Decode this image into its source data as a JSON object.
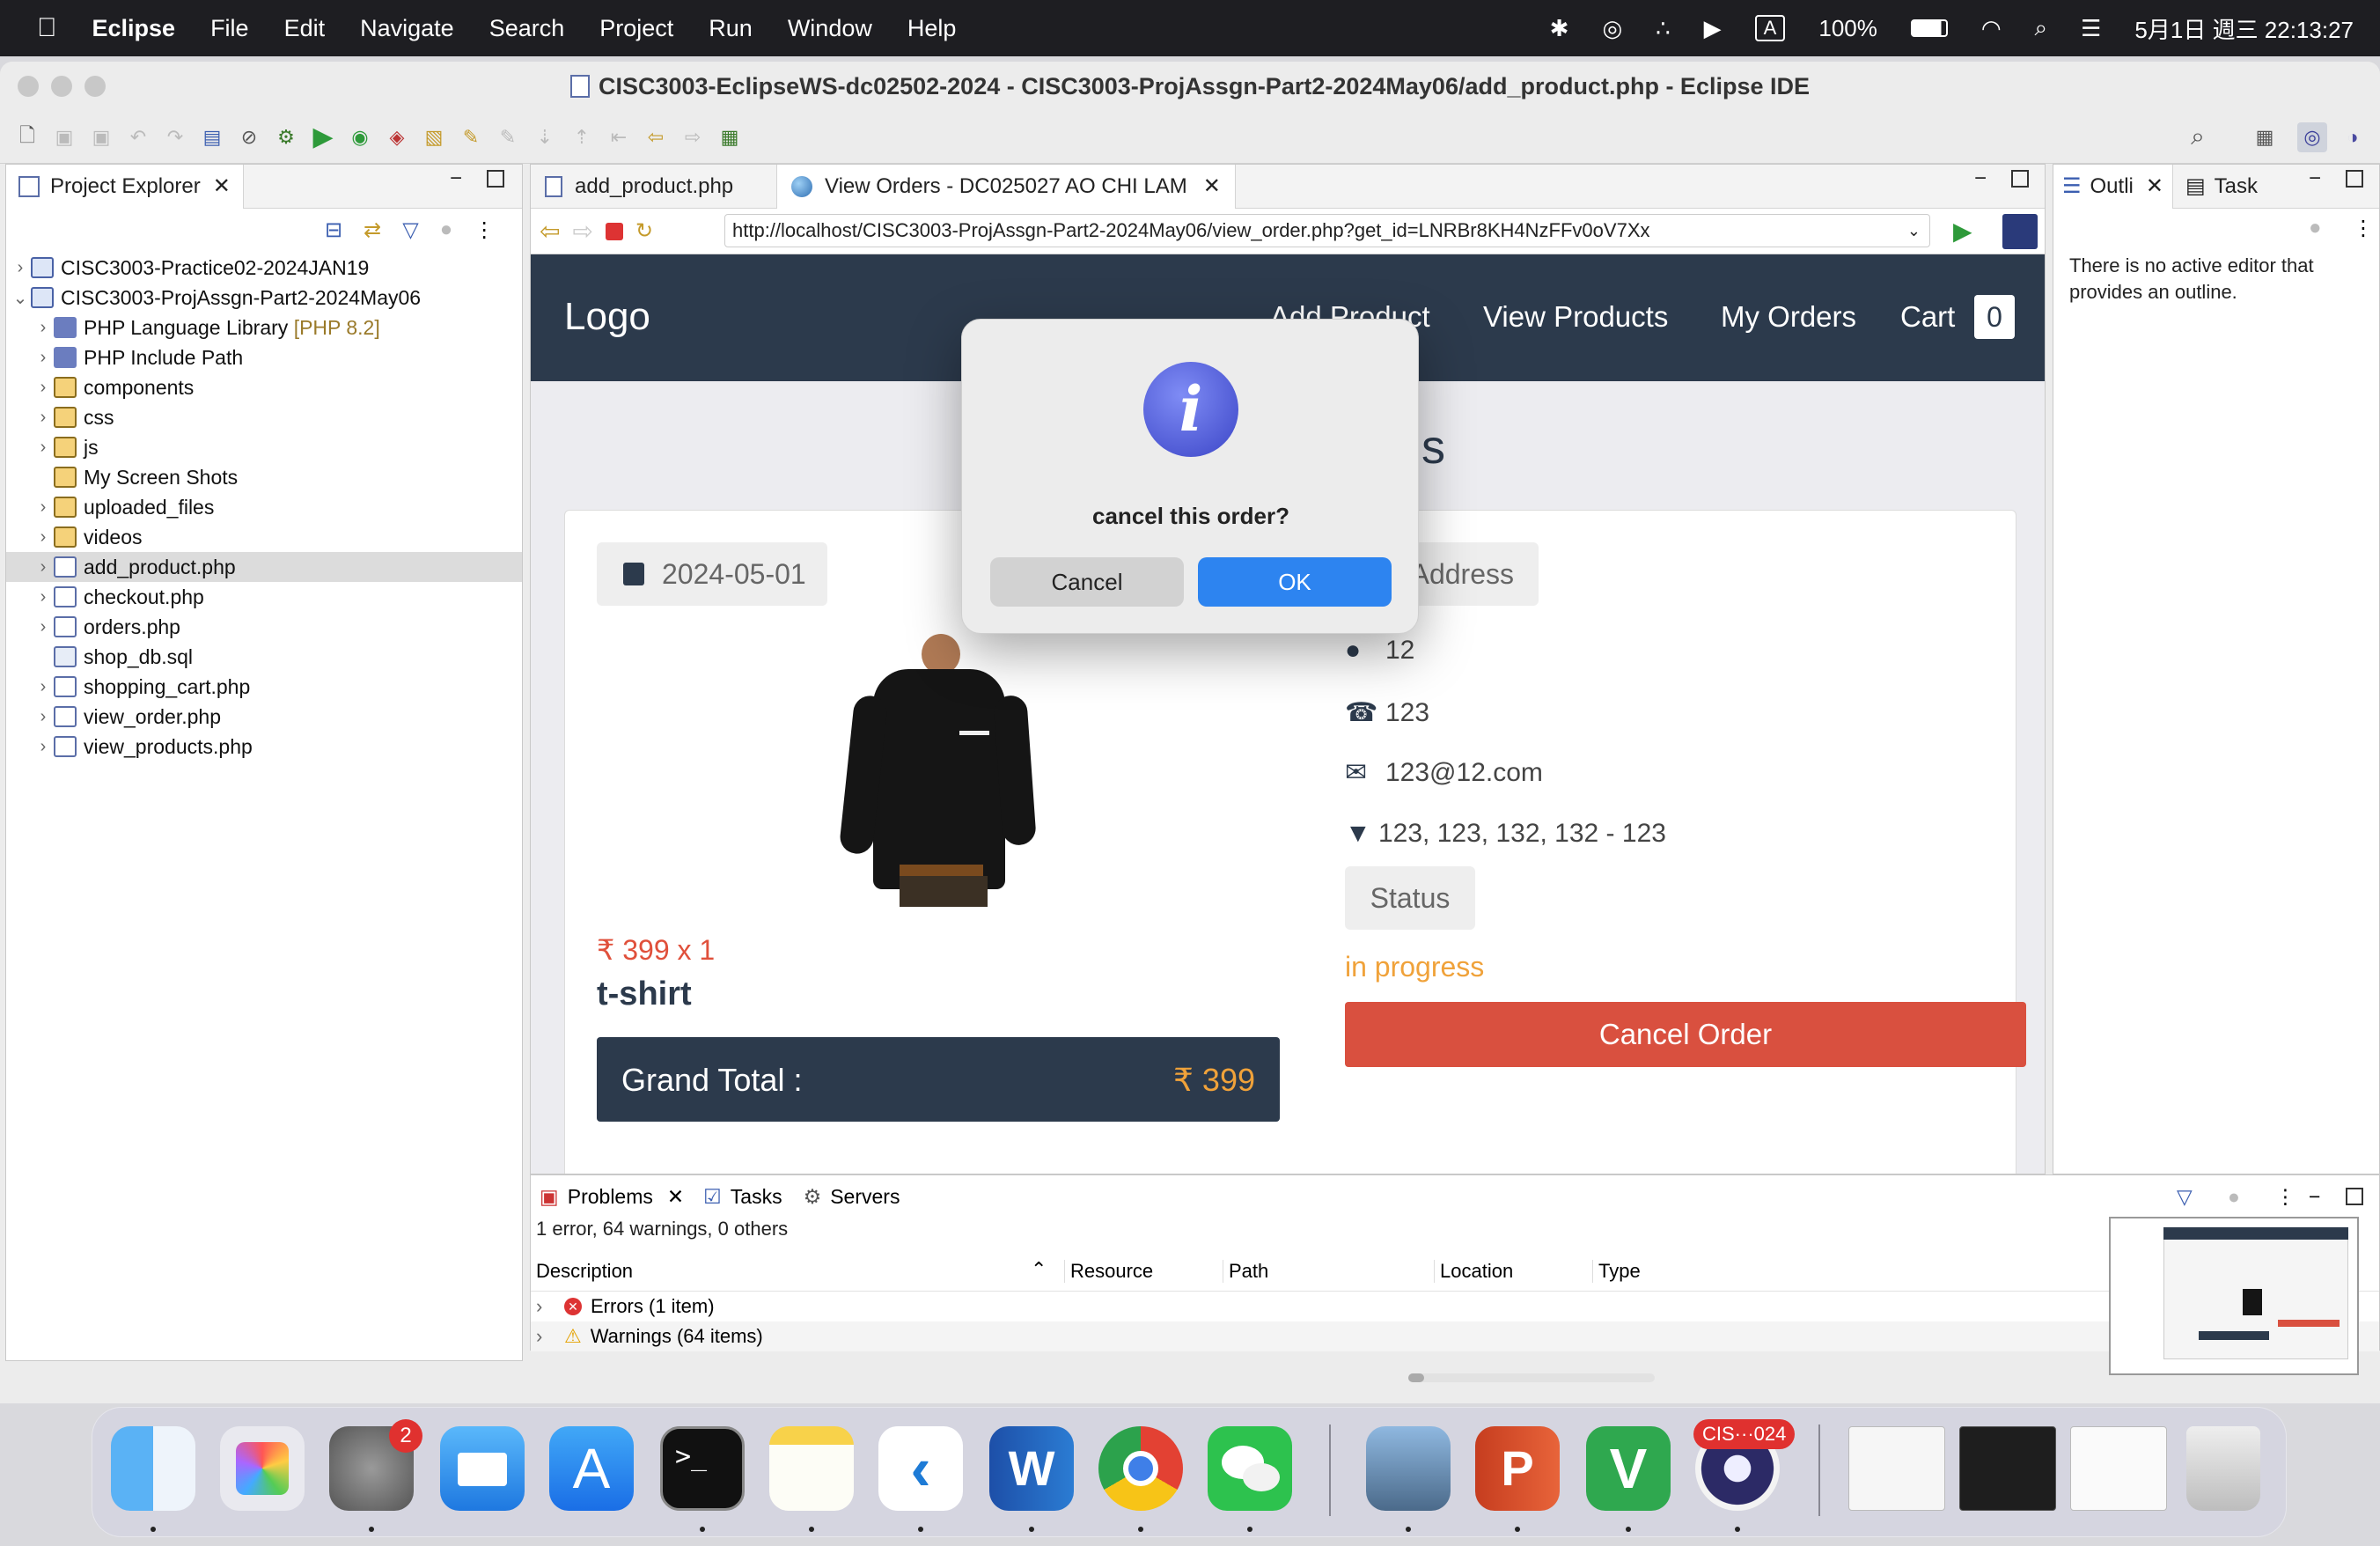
{
  "menubar": {
    "app": "Eclipse",
    "items": [
      "File",
      "Edit",
      "Navigate",
      "Search",
      "Project",
      "Run",
      "Window",
      "Help"
    ],
    "battery": "100%",
    "datetime": "5月1日 週三 22:13:27",
    "input_source": "A"
  },
  "window": {
    "title": "CISC3003-EclipseWS-dc02502-2024 - CISC3003-ProjAssgn-Part2-2024May06/add_product.php - Eclipse IDE"
  },
  "project_explorer": {
    "tab_label": "Project Explorer",
    "items": [
      {
        "label": "CISC3003-Practice02-2024JAN19",
        "suffix": ""
      },
      {
        "label": "CISC3003-ProjAssgn-Part2-2024May06",
        "suffix": ""
      },
      {
        "label": "PHP Language Library",
        "suffix": "[PHP 8.2]"
      },
      {
        "label": "PHP Include Path",
        "suffix": ""
      },
      {
        "label": "components",
        "suffix": ""
      },
      {
        "label": "css",
        "suffix": ""
      },
      {
        "label": "js",
        "suffix": ""
      },
      {
        "label": "My Screen Shots",
        "suffix": ""
      },
      {
        "label": "uploaded_files",
        "suffix": ""
      },
      {
        "label": "videos",
        "suffix": ""
      },
      {
        "label": "add_product.php",
        "suffix": ""
      },
      {
        "label": "checkout.php",
        "suffix": ""
      },
      {
        "label": "orders.php",
        "suffix": ""
      },
      {
        "label": "shop_db.sql",
        "suffix": ""
      },
      {
        "label": "shopping_cart.php",
        "suffix": ""
      },
      {
        "label": "view_order.php",
        "suffix": ""
      },
      {
        "label": "view_products.php",
        "suffix": ""
      }
    ]
  },
  "editor": {
    "tabs": [
      {
        "label": "add_product.php"
      },
      {
        "label": "View Orders - DC025027 AO CHI LAM"
      }
    ],
    "url": "http://localhost/CISC3003-ProjAssgn-Part2-2024May06/view_order.php?get_id=LNRBr8KH4NzFFv0oV7Xx"
  },
  "site": {
    "logo": "Logo",
    "nav": [
      "Add Product",
      "View Products",
      "My Orders"
    ],
    "cart_label": "Cart",
    "cart_count": "0",
    "heading_visible": "ls",
    "order": {
      "date": "2024-05-01",
      "price_line": "₹ 399 x 1",
      "product_name": "t-shirt",
      "grand_total_label": "Grand Total :",
      "grand_total_value": "₹ 399",
      "address_header": "Address",
      "name": "12",
      "phone": "123",
      "email": "123@12.com",
      "address": "123, 123, 132, 132 - 123",
      "status_label": "Status",
      "status_value": "in progress",
      "cancel_button": "Cancel Order"
    }
  },
  "dialog": {
    "message": "cancel this order?",
    "cancel": "Cancel",
    "ok": "OK"
  },
  "outline": {
    "tab1": "Outli",
    "tab2": "Task",
    "message": "There is no active editor that provides an outline."
  },
  "problems": {
    "tabs": [
      "Problems",
      "Tasks",
      "Servers"
    ],
    "summary": "1 error, 64 warnings, 0 others",
    "columns": [
      "Description",
      "Resource",
      "Path",
      "Location",
      "Type"
    ],
    "rows": [
      "Errors (1 item)",
      "Warnings (64 items)"
    ]
  },
  "dock": {
    "settings_badge": "2",
    "eclipse_label": "CIS···024"
  },
  "colors": {
    "nav_bg": "#2c3a4c",
    "accent_red": "#d9503f",
    "status_orange": "#f0a23a",
    "ok_blue": "#2d84f0",
    "price_red": "#e0503b"
  }
}
